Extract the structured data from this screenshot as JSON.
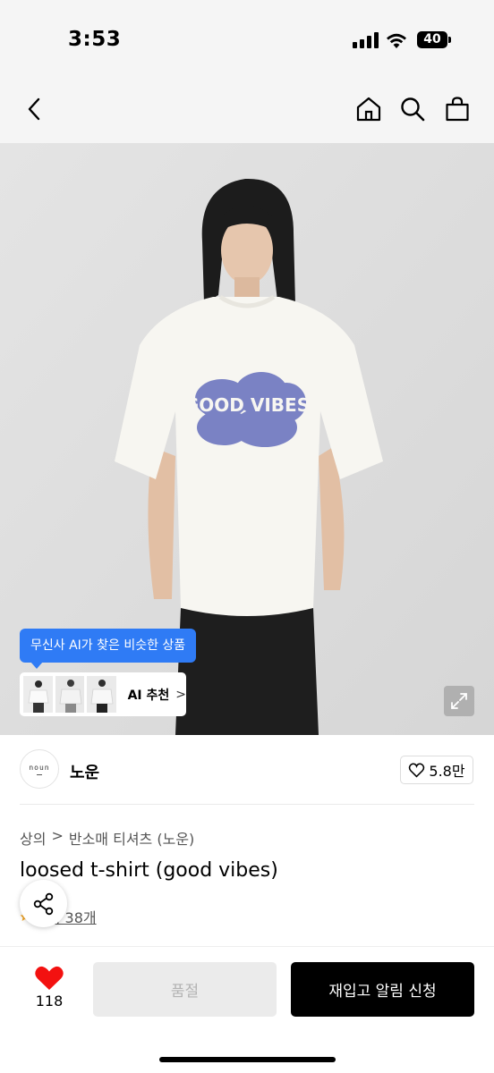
{
  "status_bar": {
    "time": "3:53",
    "battery": "40"
  },
  "nav": {
    "icons": [
      "back-icon",
      "home-icon",
      "search-icon",
      "shopping-bag-icon"
    ]
  },
  "hero": {
    "shirt_print": "GOOD VIBES",
    "ai_tooltip": "무신사 AI가 찾은 비슷한 상품",
    "ai_recommend_label": "AI 추천",
    "ai_recommend_chevron": ">",
    "expand_icon": "expand-icon"
  },
  "brand": {
    "logo_text": "noun",
    "name": "노운",
    "like_count": "5.8만"
  },
  "product": {
    "breadcrumb": [
      "상의",
      "반소매 티셔츠 (노운)"
    ],
    "breadcrumb_separator": ">",
    "title": "loosed t-shirt (good vibes)",
    "review_link": "후기 38개"
  },
  "bottom_bar": {
    "wish_count": "118",
    "soldout_label": "품절",
    "restock_label": "재입고 알림 신청"
  },
  "colors": {
    "accent_blue": "#2f7bf5",
    "heart_red": "#f31110",
    "shirt_print": "#7a82c4"
  }
}
